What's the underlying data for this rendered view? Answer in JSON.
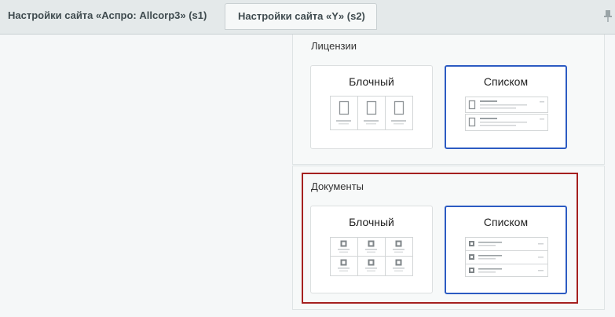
{
  "tabs": [
    {
      "label": "Настройки сайта «Аспро: Allcorp3» (s1)",
      "active": false
    },
    {
      "label": "Настройки сайта «Y» (s2)",
      "active": true
    }
  ],
  "licenses": {
    "title": "Лицензии",
    "options": [
      {
        "label": "Блочный",
        "selected": false
      },
      {
        "label": "Списком",
        "selected": true
      }
    ]
  },
  "documents": {
    "title": "Документы",
    "options": [
      {
        "label": "Блочный",
        "selected": false
      },
      {
        "label": "Списком",
        "selected": true
      }
    ]
  },
  "colors": {
    "selected_border": "#2c5bc2",
    "highlight_frame": "#a5201f"
  },
  "icons": {
    "pin": "pin-icon",
    "block_view": "block-layout-preview",
    "list_view": "list-layout-preview"
  }
}
